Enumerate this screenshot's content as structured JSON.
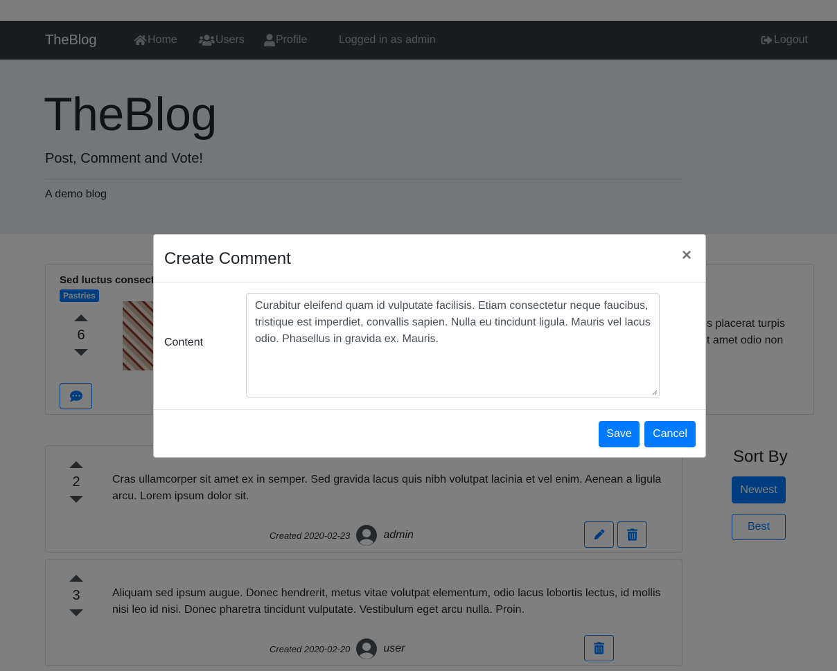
{
  "navbar": {
    "brand": "TheBlog",
    "home": "Home",
    "users": "Users",
    "profile": "Profile",
    "logged_in": "Logged in as admin",
    "logout": "Logout"
  },
  "jumbotron": {
    "title": "TheBlog",
    "lead": "Post, Comment and Vote!",
    "description": "A demo blog"
  },
  "post": {
    "title": "Sed luctus consect",
    "category": "Pastries",
    "votes": "6",
    "text_line1": "s placerat turpis",
    "text_line2": "t amet odio non"
  },
  "comments": [
    {
      "votes": "2",
      "text": "Cras ullamcorper sit amet ex in semper. Sed gravida lacus quis nibh volutpat lacinia et vel enim. Aenean a ligula arcu. Lorem ipsum dolor sit.",
      "created": "Created 2020-02-23",
      "author": "admin"
    },
    {
      "votes": "3",
      "text": "Aliquam sed ipsum augue. Donec hendrerit, metus vitae volutpat elementum, odio lacus lobortis lectus, id mollis nisi leo id nisi. Donec pharetra tincidunt vulputate. Vestibulum eget arcu nulla. Proin.",
      "created": "Created 2020-02-20",
      "author": "user"
    }
  ],
  "sort": {
    "title": "Sort By",
    "newest": "Newest",
    "best": "Best"
  },
  "modal": {
    "title": "Create Comment",
    "close": "×",
    "content_label": "Content",
    "content_value": "Curabitur eleifend quam id vulputate facilisis. Etiam consectetur neque faucibus, tristique est imperdiet, convallis sapien. Nulla eu tincidunt ligula. Mauris vel lacus odio. Phasellus in gravida ex. Mauris.",
    "save": "Save",
    "cancel": "Cancel"
  },
  "colors": {
    "primary": "#007bff",
    "navbar": "#343a40",
    "jumbotron": "#e9ecef"
  },
  "icons": [
    "home-icon",
    "users-icon",
    "profile-icon",
    "logout-icon",
    "comment-icon",
    "edit-icon",
    "trash-icon",
    "caret-up-icon",
    "caret-down-icon",
    "avatar-icon",
    "close-icon"
  ]
}
